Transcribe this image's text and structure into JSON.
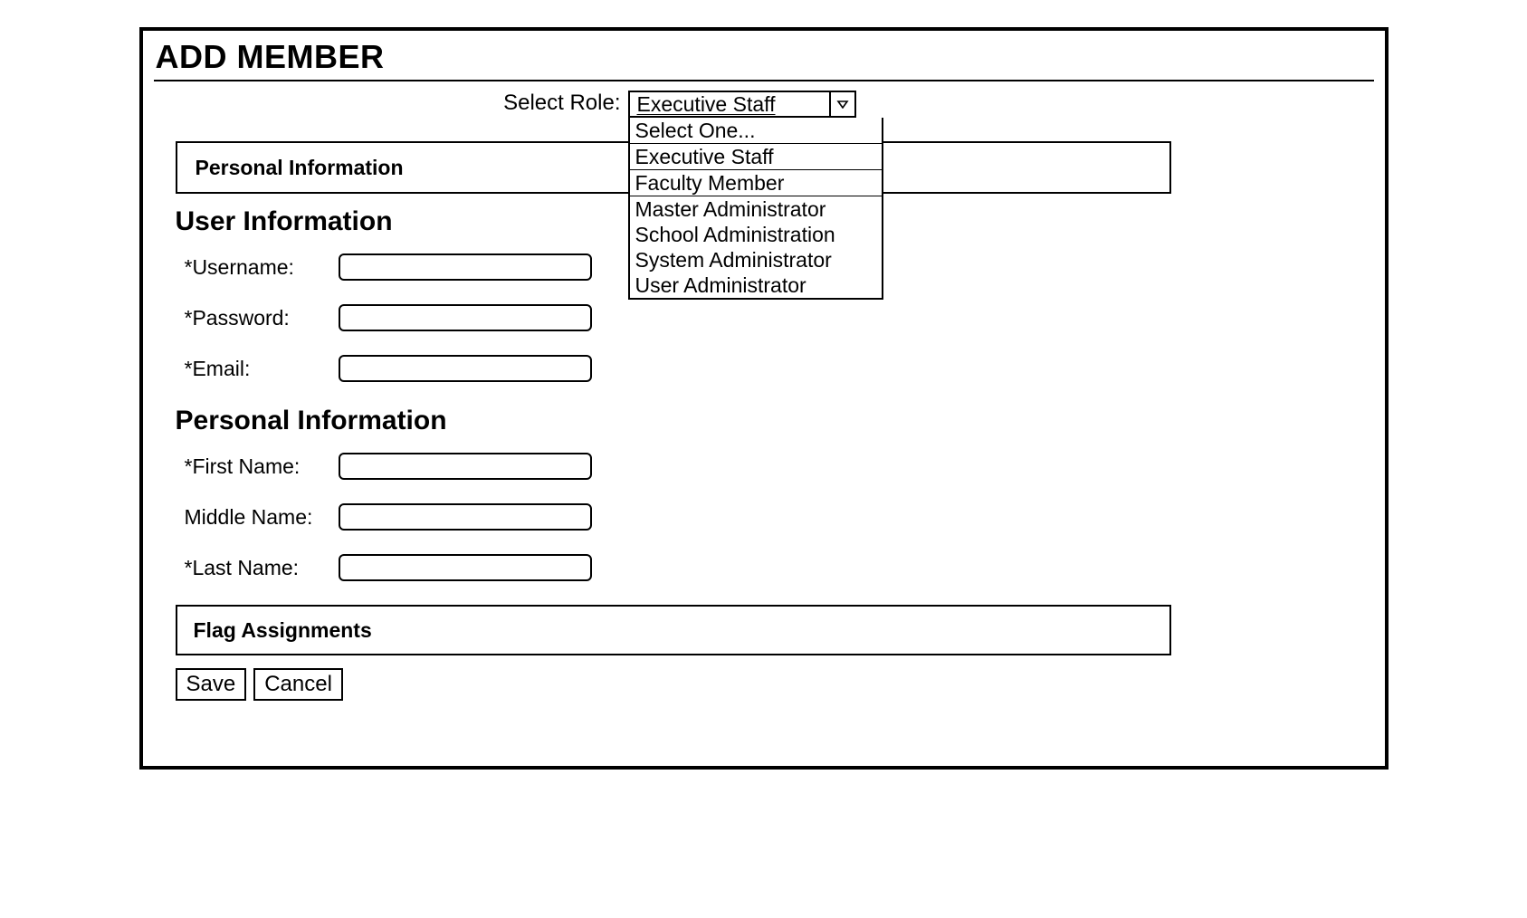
{
  "title": "ADD MEMBER",
  "role": {
    "label": "Select Role:",
    "selected": "Executive Staff",
    "options": [
      "Select One...",
      "Executive Staff",
      "Faculty Member",
      "Master Administrator",
      "School Administration",
      "System Administrator",
      "User Administrator"
    ]
  },
  "tabs": {
    "personal_info": "Personal Information"
  },
  "sections": {
    "user_info_heading": "User Information",
    "personal_info_heading": "Personal Information",
    "flag_assignments": "Flag Assignments"
  },
  "fields": {
    "username": {
      "label": "*Username:",
      "value": ""
    },
    "password": {
      "label": "*Password:",
      "value": ""
    },
    "email": {
      "label": "*Email:",
      "value": ""
    },
    "first_name": {
      "label": "*First Name:",
      "value": ""
    },
    "middle_name": {
      "label": "Middle Name:",
      "value": ""
    },
    "last_name": {
      "label": "*Last Name:",
      "value": ""
    }
  },
  "buttons": {
    "save": "Save",
    "cancel": "Cancel"
  }
}
